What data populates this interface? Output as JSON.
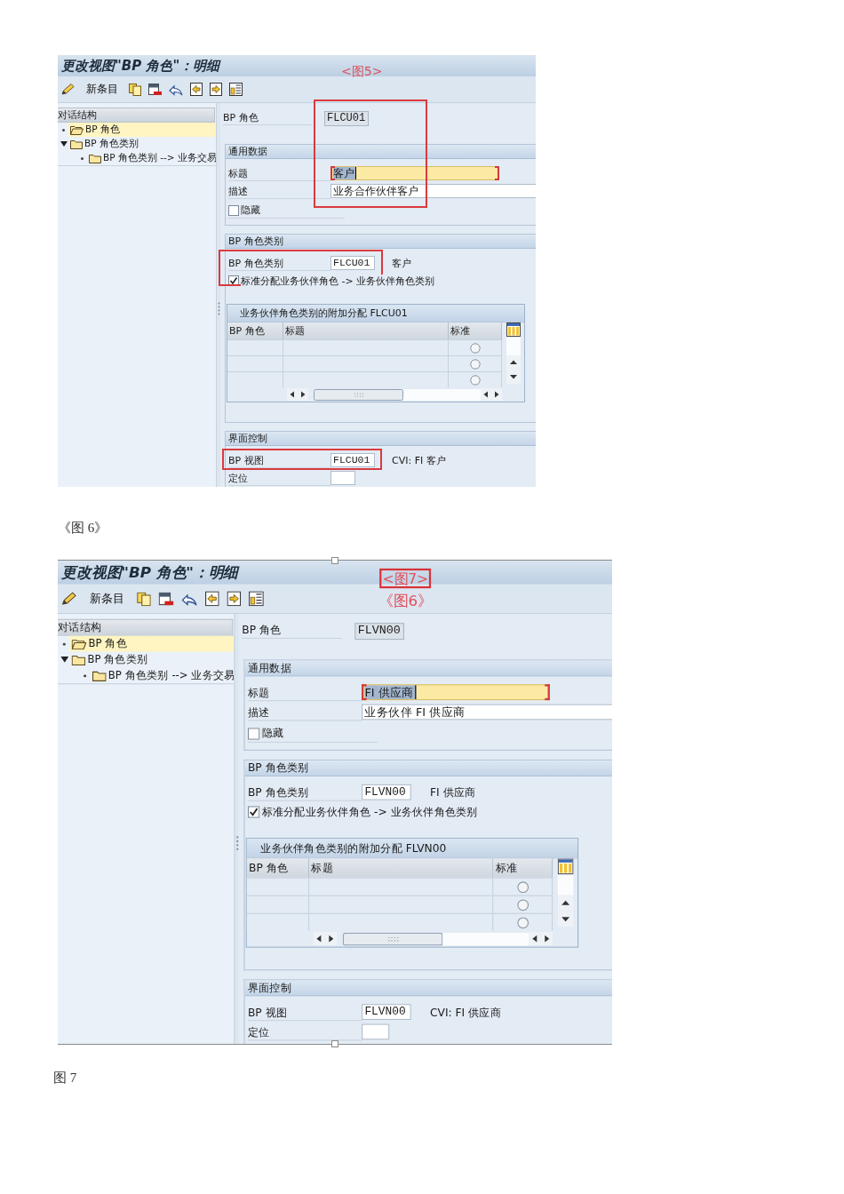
{
  "figures": [
    {
      "selected": false,
      "screen": {
        "title": "更改视图\"BP 角色\"：明细",
        "toolbar": {
          "new_entries": "新条目"
        },
        "dialog_structure": {
          "title": "对话结构",
          "items": [
            {
              "label": "BP 角色",
              "selected": true
            },
            {
              "label": "BP 角色类别",
              "selected": false,
              "expanded": true,
              "children": [
                {
                  "label": "BP 角色类别 --> 业务交易",
                  "selected": false
                }
              ]
            }
          ]
        },
        "key_field": {
          "label": "BP 角色",
          "value": "FLCU01",
          "highlighted": true
        },
        "groups": [
          {
            "title": "通用数据",
            "rows": [
              {
                "kind": "field",
                "label": "标题",
                "value": "客户",
                "focused": true
              },
              {
                "kind": "field",
                "label": "描述",
                "value": "业务合作伙伴客户",
                "focused": false
              },
              {
                "kind": "checkbox",
                "label": "隐藏",
                "checked": false
              }
            ]
          },
          {
            "title": "BP 角色类别",
            "rows": [
              {
                "kind": "field",
                "label": "BP 角色类别",
                "value": "FLCU01",
                "focused": false,
                "description": "客户",
                "highlighted": true
              },
              {
                "kind": "checkbox",
                "label": "标准分配业务伙伴角色 -> 业务伙伴角色类别",
                "checked": true
              },
              {
                "kind": "table",
                "title": "业务伙伴角色类别的附加分配 FLCU01",
                "columns": [
                  "BP 角色",
                  "标题",
                  "标准"
                ],
                "rows": [
                  {
                    "selected": false
                  },
                  {
                    "selected": false
                  },
                  {
                    "selected": false
                  }
                ]
              }
            ]
          },
          {
            "title": "界面控制",
            "rows": [
              {
                "kind": "field",
                "label": "BP 视图",
                "value": "FLCU01",
                "focused": false,
                "description": "CVI: FI 客户",
                "highlighted": true
              },
              {
                "kind": "field",
                "label": "定位",
                "focused": false
              }
            ]
          }
        ]
      },
      "annotations": [
        {
          "text": "<图5>",
          "boxed": false
        }
      ],
      "caption": "《图 6》"
    },
    {
      "selected": true,
      "screen": {
        "title": "更改视图\"BP 角色\"：明细",
        "toolbar": {
          "new_entries": "新条目"
        },
        "dialog_structure": {
          "title": "对话结构",
          "items": [
            {
              "label": "BP 角色",
              "selected": true
            },
            {
              "label": "BP 角色类别",
              "selected": false,
              "expanded": true,
              "children": [
                {
                  "label": "BP 角色类别 --> 业务交易",
                  "selected": false
                }
              ]
            }
          ]
        },
        "key_field": {
          "label": "BP 角色",
          "value": "FLVN00"
        },
        "groups": [
          {
            "title": "通用数据",
            "rows": [
              {
                "kind": "field",
                "label": "标题",
                "value": "FI 供应商",
                "focused": true
              },
              {
                "kind": "field",
                "label": "描述",
                "value": "业务伙伴 FI 供应商",
                "focused": false
              },
              {
                "kind": "checkbox",
                "label": "隐藏",
                "checked": false
              }
            ]
          },
          {
            "title": "BP 角色类别",
            "rows": [
              {
                "kind": "field",
                "label": "BP 角色类别",
                "value": "FLVN00",
                "focused": false,
                "description": "FI 供应商"
              },
              {
                "kind": "checkbox",
                "label": "标准分配业务伙伴角色 -> 业务伙伴角色类别",
                "checked": true
              },
              {
                "kind": "table",
                "title": "业务伙伴角色类别的附加分配 FLVN00",
                "columns": [
                  "BP 角色",
                  "标题",
                  "标准"
                ],
                "rows": [
                  {
                    "selected": false
                  },
                  {
                    "selected": false
                  },
                  {
                    "selected": false
                  }
                ]
              }
            ]
          },
          {
            "title": "界面控制",
            "rows": [
              {
                "kind": "field",
                "label": "BP 视图",
                "value": "FLVN00",
                "focused": false,
                "description": "CVI: FI 供应商"
              },
              {
                "kind": "field",
                "label": "定位",
                "focused": false
              }
            ]
          }
        ]
      },
      "annotations": [
        {
          "text": "<图7>",
          "boxed": true
        },
        {
          "text": "《图6》",
          "boxed": false
        }
      ],
      "caption": "图 7"
    }
  ]
}
